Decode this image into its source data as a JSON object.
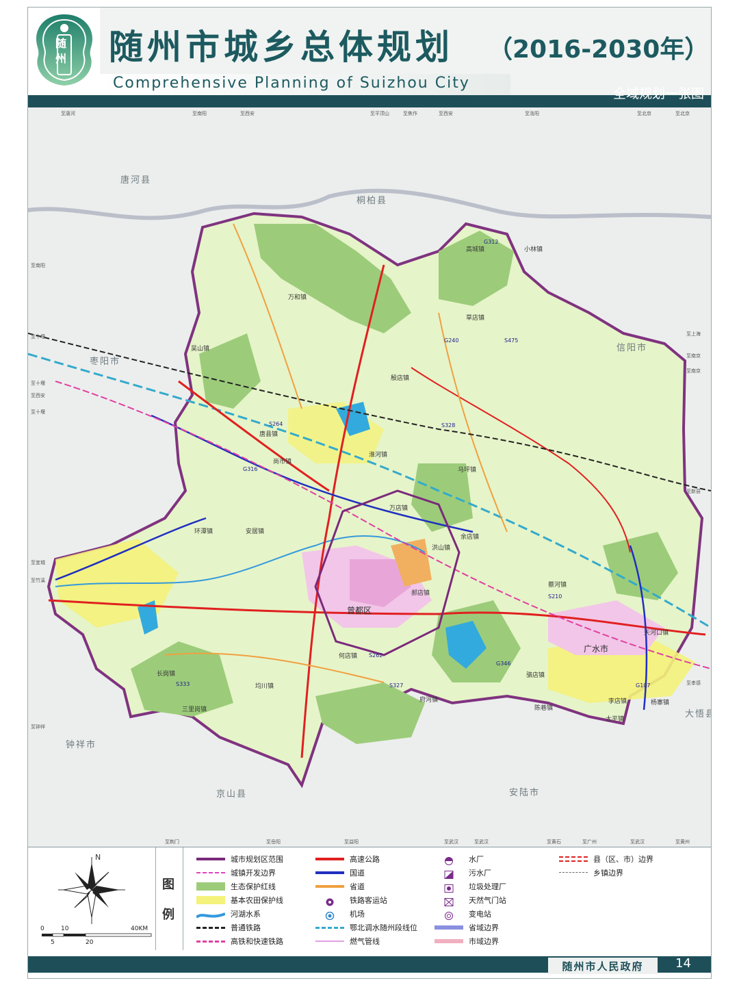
{
  "header": {
    "emblem_text": "随州",
    "title_cn": "随州市城乡总体规划",
    "title_years": "（2016-2030年）",
    "title_en": "Comprehensive Planning of Suizhou City",
    "subtitle": "全域规划一张图"
  },
  "map": {
    "neighbors": [
      "唐河县",
      "桐柏县",
      "枣阳市",
      "信阳市",
      "钟祥市",
      "京山县",
      "安陆市",
      "广水市",
      "大悟县"
    ],
    "districts": [
      "曾都区",
      "广水市"
    ],
    "towns": [
      "万和镇",
      "吴山镇",
      "草店镇",
      "殷店镇",
      "高城镇",
      "小林镇",
      "环潭镇",
      "唐县镇",
      "淮河镇",
      "安居镇",
      "何店镇",
      "洪山镇",
      "长岗镇",
      "三里岗镇",
      "均川镇",
      "府河镇",
      "万店镇",
      "吴山镇",
      "骆店镇",
      "太平镇",
      "李店镇",
      "杨寨镇",
      "蔡河镇",
      "郝店镇",
      "余店镇",
      "陈巷镇",
      "马坪镇",
      "尚市镇",
      "天河口镇",
      "北郊"
    ],
    "edge_labels_top": [
      "至唐河",
      "至南阳",
      "至西安",
      "至平顶山",
      "至焦作",
      "至西安",
      "至洛阳",
      "至北京",
      "至北京"
    ],
    "edge_labels_bottom": [
      "至荆门",
      "至岳阳",
      "至益阳",
      "至武汉",
      "至武汉",
      "至黄石",
      "至广州",
      "至武汉",
      "至黄州"
    ],
    "edge_labels_left": [
      "至南阳",
      "至十堰",
      "至十堰",
      "至西安",
      "至十堰",
      "至宜城",
      "至竹溪",
      "至钟祥"
    ],
    "edge_labels_right": [
      "至上海",
      "至南京",
      "至南京",
      "至新县",
      "至孝感"
    ],
    "road_labels": [
      "G312",
      "G107",
      "G316",
      "G346",
      "G240",
      "S264",
      "S328",
      "S475",
      "S210",
      "S262",
      "S327",
      "S333"
    ]
  },
  "legend": {
    "heading_1": "图",
    "heading_2": "例",
    "compass_north": "N",
    "scale_top": [
      "0",
      "10",
      "40KM"
    ],
    "scale_bottom": [
      "5",
      "20"
    ],
    "items": [
      {
        "label": "城市规划区范围",
        "sym": "boundary-purple"
      },
      {
        "label": "城镇开发边界",
        "sym": "dash-magenta"
      },
      {
        "label": "生态保护红线",
        "sym": "fill-green"
      },
      {
        "label": "基本农田保护线",
        "sym": "fill-yellow"
      },
      {
        "label": "河湖水系",
        "sym": "river"
      },
      {
        "label": "普通铁路",
        "sym": "rail"
      },
      {
        "label": "高铁和快速铁路",
        "sym": "hsr"
      },
      {
        "label": "高速公路",
        "sym": "expressway"
      },
      {
        "label": "国道",
        "sym": "national"
      },
      {
        "label": "省道",
        "sym": "provincial"
      },
      {
        "label": "铁路客运站",
        "sym": "station"
      },
      {
        "label": "机场",
        "sym": "airport"
      },
      {
        "label": "鄂北调水随州段线位",
        "sym": "canal"
      },
      {
        "label": "燃气管线",
        "sym": "gas"
      },
      {
        "label": "水厂",
        "sym": "water"
      },
      {
        "label": "污水厂",
        "sym": "sewage"
      },
      {
        "label": "垃圾处理厂",
        "sym": "garbage"
      },
      {
        "label": "天然气门站",
        "sym": "gasgate"
      },
      {
        "label": "变电站",
        "sym": "substation"
      },
      {
        "label": "省域边界",
        "sym": "prov-border"
      },
      {
        "label": "市域边界",
        "sym": "city-border"
      },
      {
        "label": "县（区、市）边界",
        "sym": "county-border"
      },
      {
        "label": "乡镇边界",
        "sym": "town-border"
      }
    ]
  },
  "footer": {
    "org": "随州市人民政府",
    "page": "14"
  },
  "colors": {
    "header_band": "#1e4f59",
    "title": "#1c5a60",
    "green_zone": "#9ccc7a",
    "farmland": "#f4f27a",
    "urban": "#f2c6e8",
    "expressway": "#e02020",
    "national_road": "#1f2fc0",
    "provincial_road": "#f0a040",
    "county_boundary": "#7a2a7a"
  }
}
